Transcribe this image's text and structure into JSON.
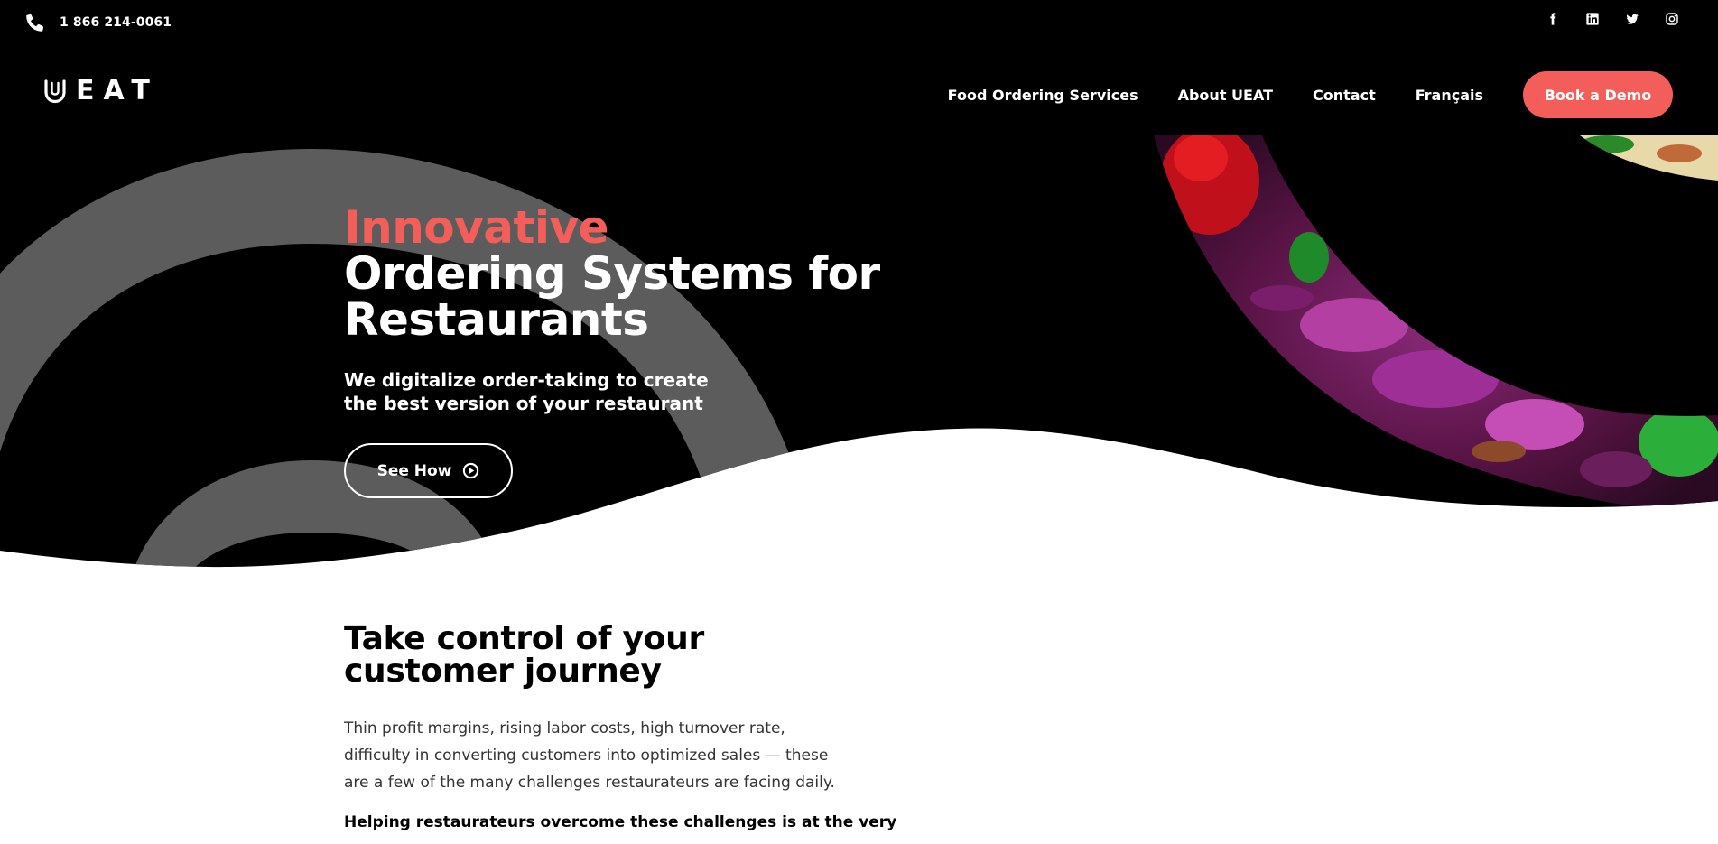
{
  "colors": {
    "hero_background": "#000000",
    "accent": "#f45e5a",
    "decorative_arc": "#5c5c5c",
    "text_light": "#ffffff",
    "text_dark": "#000000"
  },
  "topbar": {
    "phone_icon": "phone-icon",
    "phone_number": "1 866 214-0061",
    "social": [
      {
        "name": "facebook-icon"
      },
      {
        "name": "linkedin-icon"
      },
      {
        "name": "twitter-icon"
      },
      {
        "name": "instagram-icon"
      }
    ]
  },
  "header": {
    "logo_text": "EAT",
    "logo_mark_icon": "u-logo-icon",
    "nav": {
      "food_ordering": "Food Ordering Services",
      "about": "About UEAT",
      "contact": "Contact",
      "language": "Français",
      "cta": "Book a Demo"
    }
  },
  "hero": {
    "headline_accent": "Innovative",
    "headline": "Ordering Systems for Restaurants",
    "subtitle": "We digitalize order-taking to create the best version of your restaurant",
    "button_label": "See How",
    "button_icon": "play-circle-icon"
  },
  "intro": {
    "title": "Take control of your customer journey",
    "body": "Thin profit margins, rising labor costs, high turnover rate, difficulty in converting customers into optimized sales — these are a few of the many challenges restaurateurs are facing daily.",
    "bold_line": "Helping restaurateurs overcome these challenges is at the very"
  }
}
